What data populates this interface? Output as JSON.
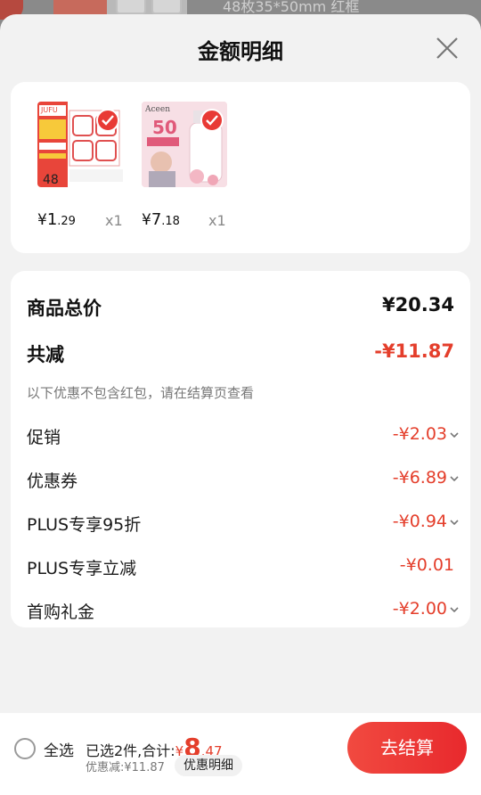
{
  "background_page": {
    "variant_text": "48枚35*50mm 红框"
  },
  "sheet": {
    "title": "金额明细"
  },
  "products": [
    {
      "price_int": "1",
      "price_dec": ".29",
      "qty": "x1",
      "brand": "JUFU",
      "badge": "48"
    },
    {
      "price_int": "7",
      "price_dec": ".18",
      "qty": "x1",
      "brand": "Aceen",
      "badge": "50"
    }
  ],
  "currency_symbol": "¥",
  "details": {
    "goods_total_label": "商品总价",
    "goods_total_value": "¥20.34",
    "total_discount_label": "共减",
    "total_discount_value": "-¥11.87",
    "discount_note": "以下优惠不包含红包，请在结算页查看",
    "items": [
      {
        "label": "促销",
        "value": "-¥2.03"
      },
      {
        "label": "优惠券",
        "value": "-¥6.89"
      },
      {
        "label": "PLUS专享95折",
        "value": "-¥0.94"
      },
      {
        "label": "PLUS专享立减",
        "value": "-¥0.01"
      },
      {
        "label": "首购礼金",
        "value": "-¥2.00"
      }
    ]
  },
  "bottom_bar": {
    "select_all_label": "全选",
    "selected_prefix": "已选2件,合计:",
    "total_yen": "¥",
    "total_int": "8",
    "total_dec": ".47",
    "discount_text": "优惠减:¥11.87",
    "detail_button": "优惠明细",
    "checkout_button": "去结算"
  },
  "colors": {
    "accent_red": "#e43e2b",
    "checkout_gradient_start": "#f14a40",
    "checkout_gradient_end": "#e8292d",
    "card_background": "#ffffff",
    "sheet_background": "#f2f2f2"
  }
}
